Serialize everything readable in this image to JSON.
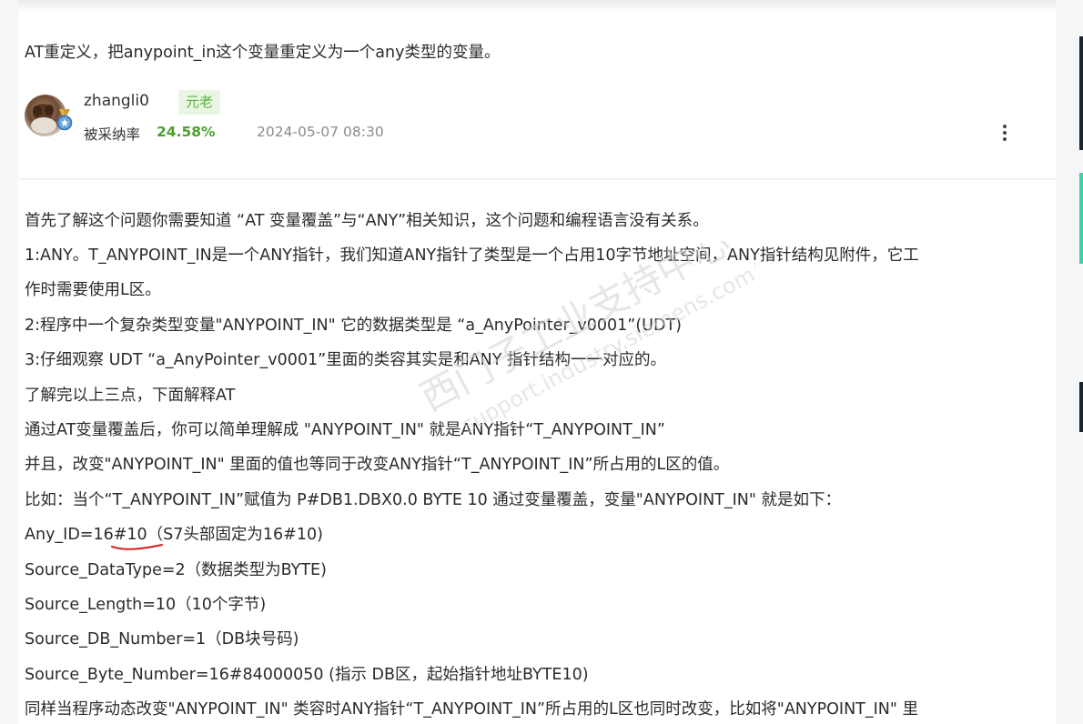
{
  "answer_top": {
    "text": "AT重定义，把anypoint_in这个变量重定义为一个any类型的变量。"
  },
  "author": {
    "username": "zhangli0",
    "rank": "元老",
    "accept_label": "被采纳率",
    "accept_rate": "24.58%",
    "timestamp": "2024-05-07 08:30",
    "more_icon": "more-vertical-icon"
  },
  "answer_body": {
    "lines": [
      "首先了解这个问题你需要知道 “AT 变量覆盖”与“ANY”相关知识，这个问题和编程语言没有关系。",
      "1:ANY。T_ANYPOINT_IN是一个ANY指针，我们知道ANY指针了类型是一个占用10字节地址空间，ANY指针结构见附件，它工",
      "作时需要使用L区。",
      "2:程序中一个复杂类型变量\"ANYPOINT_IN\" 它的数据类型是 “a_AnyPointer_v0001”(UDT)",
      "3:仔细观察 UDT “a_AnyPointer_v0001”里面的类容其实是和ANY 指针结构一一对应的。",
      "了解完以上三点，下面解释AT",
      "通过AT变量覆盖后，你可以简单理解成 \"ANYPOINT_IN\" 就是ANY指针“T_ANYPOINT_IN”",
      "并且，改变\"ANYPOINT_IN\"  里面的值也等同于改变ANY指针“T_ANYPOINT_IN”所占用的L区的值。",
      "比如：当个“T_ANYPOINT_IN”赋值为 P#DB1.DBX0.0 BYTE 10  通过变量覆盖，变量\"ANYPOINT_IN\"  就是如下：",
      "Any_ID=16#10（S7头部固定为16#10)",
      "Source_DataType=2（数据类型为BYTE)",
      "Source_Length=10（10个字节)",
      "Source_DB_Number=1（DB块号码)",
      "Source_Byte_Number=16#84000050 (指示 DB区，起始指针地址BYTE10)",
      "同样当程序动态改变\"ANYPOINT_IN\"  类容时ANY指针“T_ANYPOINT_IN”所占用的L区也同时改变，比如将\"ANYPOINT_IN\"  里"
    ]
  },
  "watermark": {
    "text_cn": "西门子工业支持中心",
    "text_url": "support.industry.siemens.com/cs"
  },
  "colors": {
    "rank_bg": "#e9f6e3",
    "rank_fg": "#59b33a",
    "accept_rate": "#4ba12d",
    "annotation": "#d81e1e"
  }
}
